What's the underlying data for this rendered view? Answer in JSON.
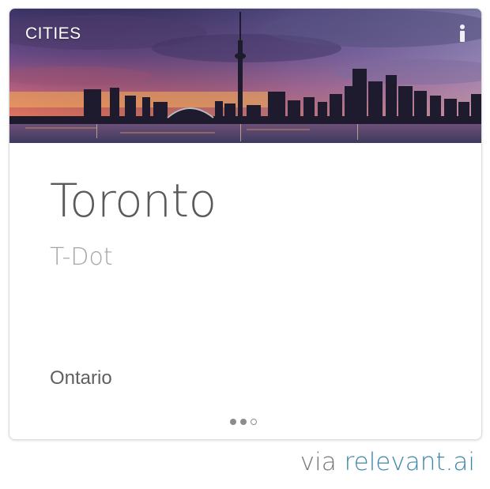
{
  "card": {
    "category_label": "CITIES",
    "city_name": "Toronto",
    "nickname": "T-Dot",
    "province": "Ontario",
    "hero_image": "toronto-skyline-sunset",
    "info_icon": "info-icon",
    "pagination": {
      "total": 3,
      "active": [
        1,
        2
      ]
    }
  },
  "footer": {
    "via_text": "via",
    "brand_text": "relevant.ai"
  },
  "colors": {
    "title": "#5a5a5a",
    "subtitle": "#a5a5a5",
    "brand": "#3d87a8",
    "via": "#777777"
  }
}
